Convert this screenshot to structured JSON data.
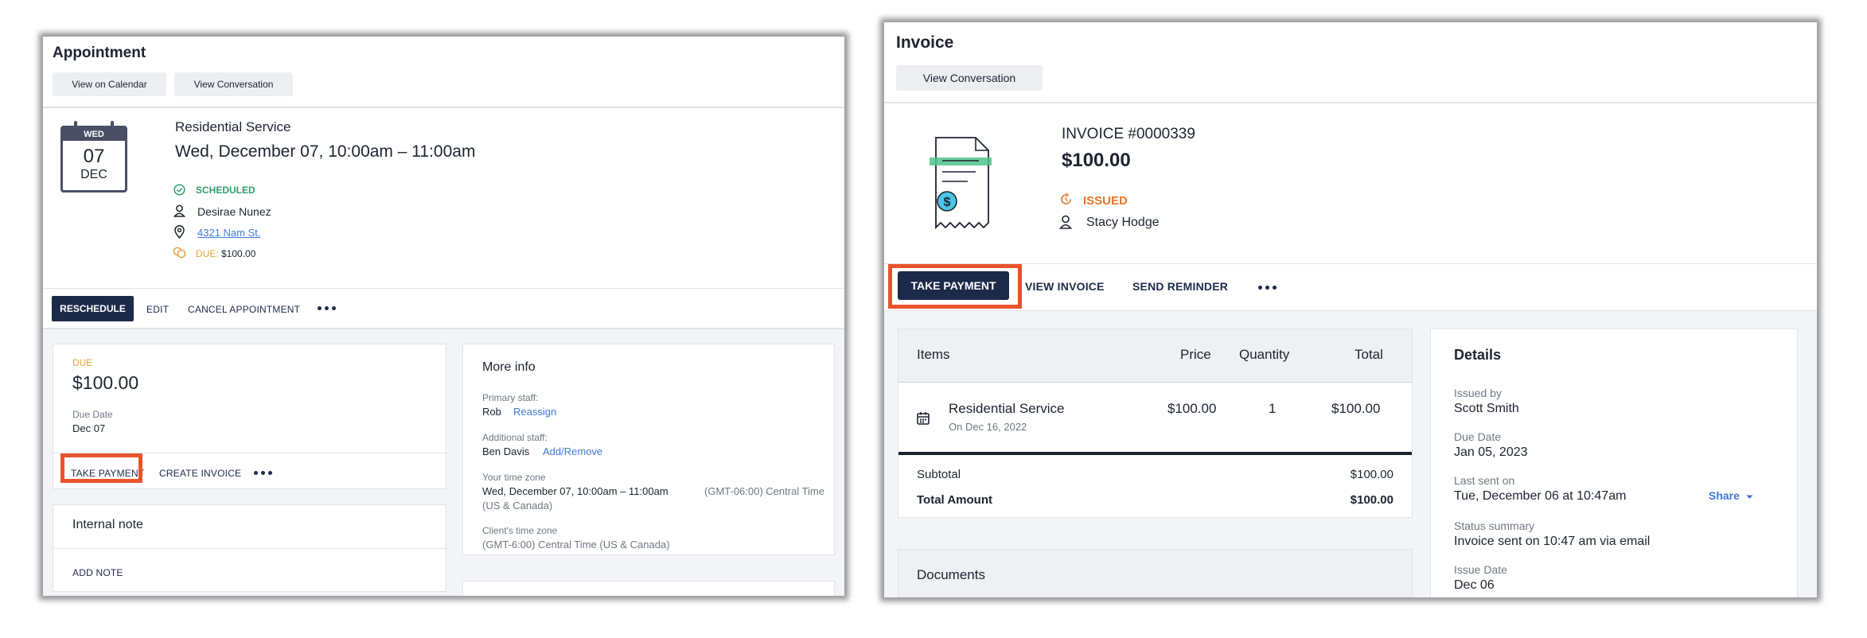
{
  "appointment": {
    "header": {
      "title": "Appointment",
      "view_calendar": "View on Calendar",
      "view_conversation": "View Conversation"
    },
    "calendar_icon": {
      "weekday": "WED",
      "day": "07",
      "month": "DEC"
    },
    "service": "Residential Service",
    "datetime": "Wed, December 07, 10:00am – 11:00am",
    "status": "SCHEDULED",
    "client": "Desirae Nunez",
    "address": "4321 Nam St.",
    "due_prefix": "DUE:",
    "due_amount": "$100.00",
    "actions": {
      "reschedule": "RESCHEDULE",
      "edit": "EDIT",
      "cancel": "CANCEL APPOINTMENT"
    },
    "due_card": {
      "label": "DUE",
      "amount": "$100.00",
      "due_date_label": "Due Date",
      "due_date": "Dec 07",
      "take_payment": "TAKE PAYMENT",
      "create_invoice": "CREATE INVOICE"
    },
    "internal_note": {
      "title": "Internal note",
      "add_note": "ADD NOTE"
    },
    "more_info": {
      "title": "More info",
      "primary_staff_label": "Primary staff:",
      "primary_staff": "Rob",
      "reassign": "Reassign",
      "additional_staff_label": "Additional staff:",
      "additional_staff": "Ben Davis",
      "add_remove": "Add/Remove",
      "your_tz_label": "Your time zone",
      "your_tz_time": "Wed, December 07, 10:00am – 11:00am",
      "your_tz_zone": "(GMT-06:00) Central Time",
      "your_tz_zone_cont": "(US & Canada)",
      "client_tz_label": "Client's time zone",
      "client_tz": "(GMT-6:00) Central Time (US & Canada)"
    },
    "colors": {
      "navy": "#1c2a4a",
      "scheduled": "#2e9e6b",
      "due": "#e8a23c",
      "link": "#3f7bd9",
      "highlight": "#e8532c"
    }
  },
  "invoice": {
    "header": {
      "title": "Invoice",
      "view_conversation": "View Conversation"
    },
    "number": "INVOICE #0000339",
    "amount": "$100.00",
    "status": "ISSUED",
    "client": "Stacy Hodge",
    "actions": {
      "take_payment": "TAKE PAYMENT",
      "view_invoice": "VIEW INVOICE",
      "send_reminder": "SEND REMINDER"
    },
    "items_table": {
      "headers": [
        "Items",
        "Price",
        "Quantity",
        "Total"
      ],
      "rows": [
        {
          "name": "Residential Service",
          "date": "On Dec 16, 2022",
          "price": "$100.00",
          "quantity": "1",
          "total": "$100.00"
        }
      ],
      "subtotal_label": "Subtotal",
      "subtotal": "$100.00",
      "total_label": "Total Amount",
      "total": "$100.00"
    },
    "documents_title": "Documents",
    "details": {
      "title": "Details",
      "issued_by_label": "Issued by",
      "issued_by": "Scott Smith",
      "due_date_label": "Due Date",
      "due_date": "Jan 05, 2023",
      "last_sent_label": "Last sent on",
      "last_sent": "Tue, December 06 at 10:47am",
      "share": "Share",
      "status_summary_label": "Status summary",
      "status_summary": "Invoice sent on 10:47 am via email",
      "issue_date_label": "Issue Date",
      "issue_date": "Dec 06"
    },
    "colors": {
      "issued": "#e8752c",
      "navy": "#1c2a4a",
      "link": "#3f7bd9"
    }
  }
}
